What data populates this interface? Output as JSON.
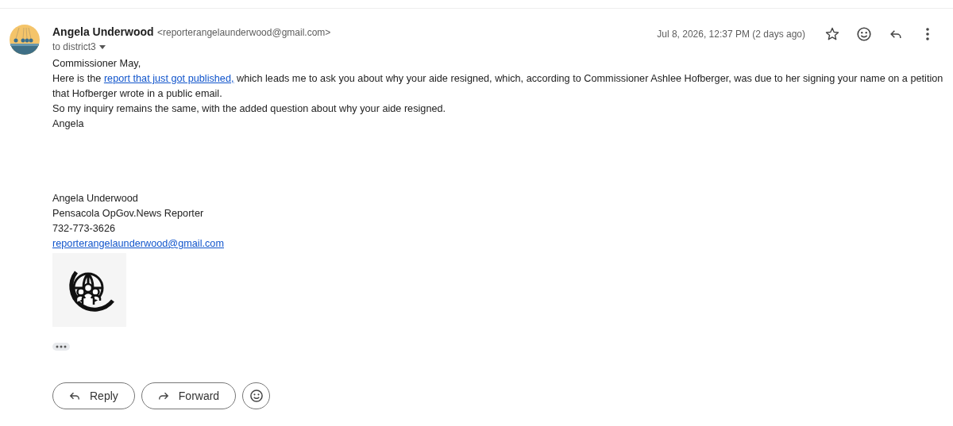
{
  "header": {
    "sender_name": "Angela Underwood",
    "sender_email": "<reporterangelaunderwood@gmail.com>",
    "recipient": "to district3",
    "date": "Jul 8, 2026, 12:37 PM (2 days ago)",
    "starred": false
  },
  "body": {
    "greeting": "Commissioner May,",
    "paragraph": {
      "before": "Here is the ",
      "link": "report that just got published,",
      "after": " which leads me to ask you about why your aide resigned, which, according to Commissioner Ashlee Hofberger, was due to her signing your name on a petition that Hofberger wrote in a public email."
    },
    "lines": [
      "So my inquiry remains the same, with the added question about why your aide resigned.",
      "Angela"
    ]
  },
  "signature": {
    "name": "Angela Underwood",
    "title": "Pensacola OpGov.News Reporter",
    "phone": "732-773-3626",
    "email": "reporterangelaunderwood@gmail.com"
  },
  "actions": [
    {
      "kind": "reply",
      "label": "Reply"
    },
    {
      "kind": "forward",
      "label": "Forward"
    },
    {
      "kind": "emoji"
    }
  ]
}
